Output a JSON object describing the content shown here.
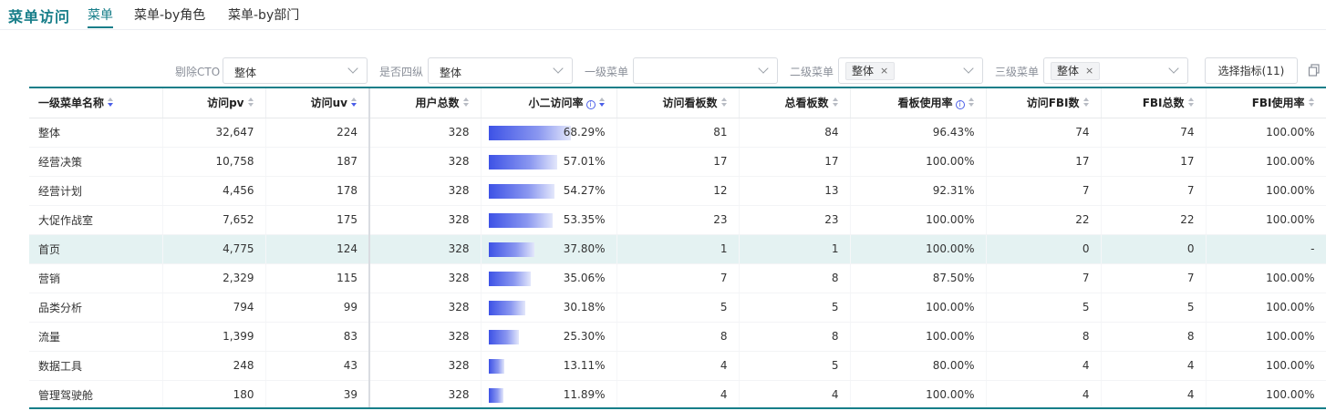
{
  "header": {
    "title": "菜单访问",
    "tabs": [
      {
        "label": "菜单",
        "active": true
      },
      {
        "label": "菜单-by角色",
        "active": false
      },
      {
        "label": "菜单-by部门",
        "active": false
      }
    ]
  },
  "filters": {
    "exclude_cto": {
      "label": "剔除CTO",
      "value": "整体"
    },
    "four_vertical": {
      "label": "是否四纵",
      "value": "整体"
    },
    "level1": {
      "label": "一级菜单",
      "value": ""
    },
    "level2": {
      "label": "二级菜单",
      "tag": "整体"
    },
    "level3": {
      "label": "三级菜单",
      "tag": "整体"
    },
    "metric_button": "选择指标(11)"
  },
  "colors": {
    "accent": "#177e89",
    "bar": "#3d52e6",
    "highlight_row": "#e4f2f2"
  },
  "table": {
    "columns": [
      "一级菜单名称",
      "访问pv",
      "访问uv",
      "用户总数",
      "小二访问率",
      "访问看板数",
      "总看板数",
      "看板使用率",
      "访问FBI数",
      "FBI总数",
      "FBI使用率"
    ],
    "rows": [
      {
        "name": "整体",
        "pv": "32,647",
        "uv": "224",
        "users": "328",
        "rate": "68.29%",
        "rate_value": 68.29,
        "visited_boards": "81",
        "total_boards": "84",
        "board_usage": "96.43%",
        "visited_fbi": "74",
        "total_fbi": "74",
        "fbi_usage": "100.00%"
      },
      {
        "name": "经营决策",
        "pv": "10,758",
        "uv": "187",
        "users": "328",
        "rate": "57.01%",
        "rate_value": 57.01,
        "visited_boards": "17",
        "total_boards": "17",
        "board_usage": "100.00%",
        "visited_fbi": "17",
        "total_fbi": "17",
        "fbi_usage": "100.00%"
      },
      {
        "name": "经营计划",
        "pv": "4,456",
        "uv": "178",
        "users": "328",
        "rate": "54.27%",
        "rate_value": 54.27,
        "visited_boards": "12",
        "total_boards": "13",
        "board_usage": "92.31%",
        "visited_fbi": "7",
        "total_fbi": "7",
        "fbi_usage": "100.00%"
      },
      {
        "name": "大促作战室",
        "pv": "7,652",
        "uv": "175",
        "users": "328",
        "rate": "53.35%",
        "rate_value": 53.35,
        "visited_boards": "23",
        "total_boards": "23",
        "board_usage": "100.00%",
        "visited_fbi": "22",
        "total_fbi": "22",
        "fbi_usage": "100.00%"
      },
      {
        "name": "首页",
        "pv": "4,775",
        "uv": "124",
        "users": "328",
        "rate": "37.80%",
        "rate_value": 37.8,
        "visited_boards": "1",
        "total_boards": "1",
        "board_usage": "100.00%",
        "visited_fbi": "0",
        "total_fbi": "0",
        "fbi_usage": "-",
        "highlight": true
      },
      {
        "name": "营销",
        "pv": "2,329",
        "uv": "115",
        "users": "328",
        "rate": "35.06%",
        "rate_value": 35.06,
        "visited_boards": "7",
        "total_boards": "8",
        "board_usage": "87.50%",
        "visited_fbi": "7",
        "total_fbi": "7",
        "fbi_usage": "100.00%"
      },
      {
        "name": "品类分析",
        "pv": "794",
        "uv": "99",
        "users": "328",
        "rate": "30.18%",
        "rate_value": 30.18,
        "visited_boards": "5",
        "total_boards": "5",
        "board_usage": "100.00%",
        "visited_fbi": "5",
        "total_fbi": "5",
        "fbi_usage": "100.00%"
      },
      {
        "name": "流量",
        "pv": "1,399",
        "uv": "83",
        "users": "328",
        "rate": "25.30%",
        "rate_value": 25.3,
        "visited_boards": "8",
        "total_boards": "8",
        "board_usage": "100.00%",
        "visited_fbi": "8",
        "total_fbi": "8",
        "fbi_usage": "100.00%"
      },
      {
        "name": "数据工具",
        "pv": "248",
        "uv": "43",
        "users": "328",
        "rate": "13.11%",
        "rate_value": 13.11,
        "visited_boards": "4",
        "total_boards": "5",
        "board_usage": "80.00%",
        "visited_fbi": "4",
        "total_fbi": "4",
        "fbi_usage": "100.00%"
      },
      {
        "name": "管理驾驶舱",
        "pv": "180",
        "uv": "39",
        "users": "328",
        "rate": "11.89%",
        "rate_value": 11.89,
        "visited_boards": "4",
        "total_boards": "4",
        "board_usage": "100.00%",
        "visited_fbi": "4",
        "total_fbi": "4",
        "fbi_usage": "100.00%"
      }
    ]
  }
}
